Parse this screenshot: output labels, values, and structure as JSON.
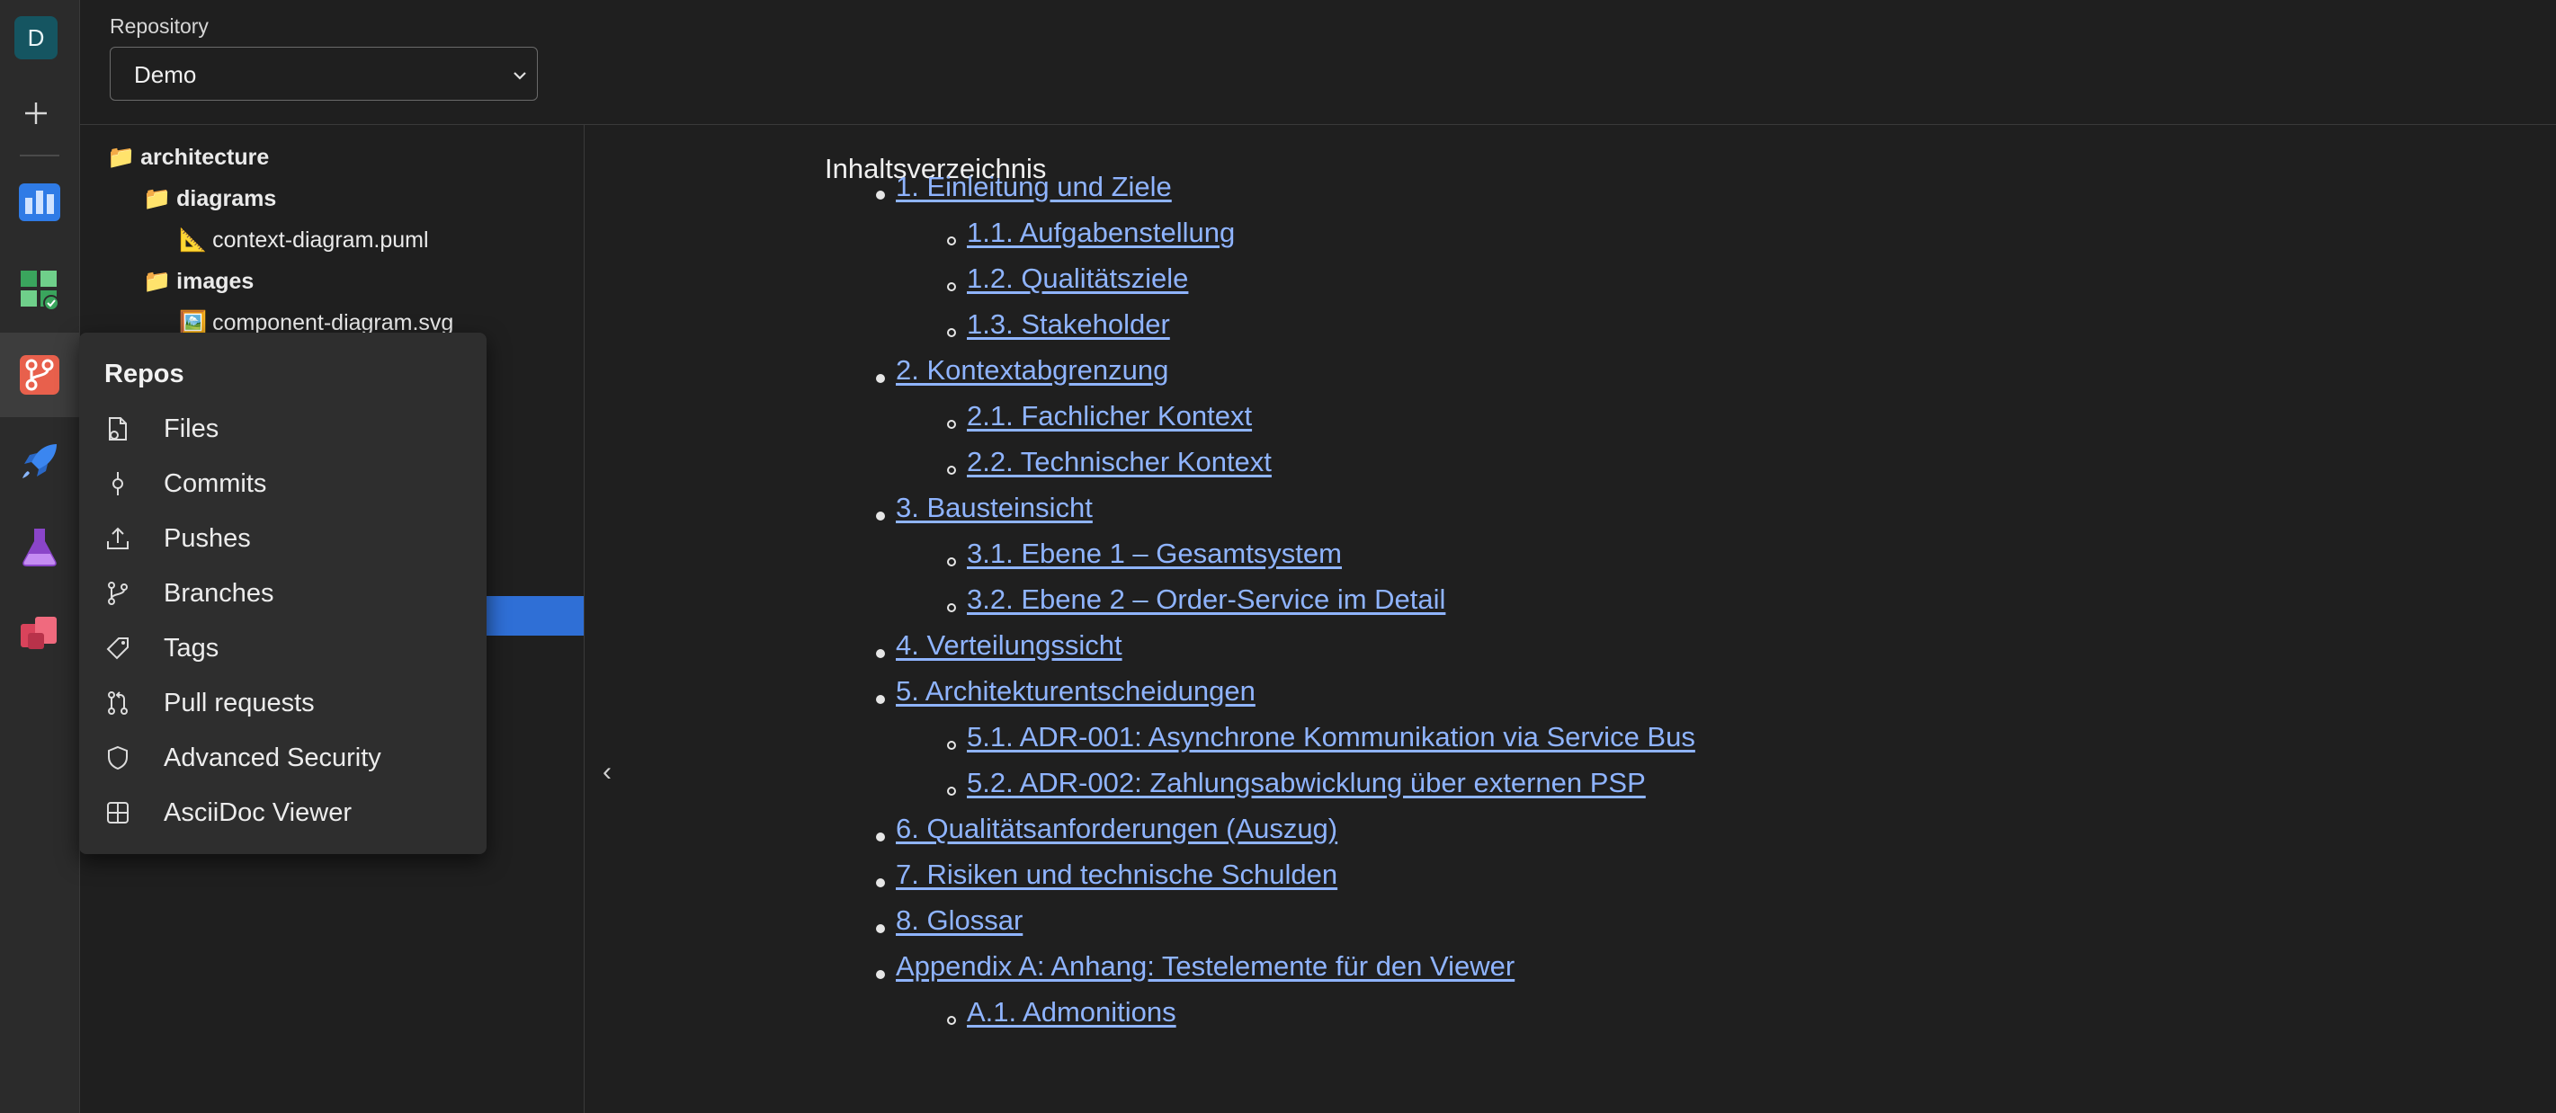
{
  "rail": {
    "avatar_letter": "D",
    "accent": "#155561"
  },
  "header": {
    "repo_label": "Repository",
    "repo_value": "Demo"
  },
  "tree": {
    "nodes": [
      {
        "label": "architecture",
        "icon": "folder-icon",
        "bold": true
      },
      {
        "label": "diagrams",
        "icon": "folder-icon",
        "bold": true
      },
      {
        "label": "context-diagram.puml",
        "icon": "triangle-ruler-icon",
        "bold": false
      },
      {
        "label": "images",
        "icon": "folder-icon",
        "bold": true
      },
      {
        "label": "component-diagram.svg",
        "icon": "image-file-icon",
        "bold": false
      }
    ]
  },
  "flyout": {
    "title": "Repos",
    "items": [
      {
        "label": "Files",
        "icon": "file-icon"
      },
      {
        "label": "Commits",
        "icon": "commit-icon"
      },
      {
        "label": "Pushes",
        "icon": "push-icon"
      },
      {
        "label": "Branches",
        "icon": "branch-icon"
      },
      {
        "label": "Tags",
        "icon": "tag-icon"
      },
      {
        "label": "Pull requests",
        "icon": "pull-request-icon"
      },
      {
        "label": "Advanced Security",
        "icon": "shield-icon"
      },
      {
        "label": "AsciiDoc Viewer",
        "icon": "grid-icon"
      }
    ]
  },
  "toc": {
    "title": "Inhaltsverzeichnis",
    "items": [
      {
        "label": "1. Einleitung und Ziele",
        "level": 1
      },
      {
        "label": "1.1. Aufgabenstellung",
        "level": 2
      },
      {
        "label": "1.2. Qualitätsziele",
        "level": 2
      },
      {
        "label": "1.3. Stakeholder",
        "level": 2
      },
      {
        "label": "2. Kontextabgrenzung",
        "level": 1
      },
      {
        "label": "2.1. Fachlicher Kontext",
        "level": 2
      },
      {
        "label": "2.2. Technischer Kontext",
        "level": 2
      },
      {
        "label": "3. Bausteinsicht",
        "level": 1
      },
      {
        "label": "3.1. Ebene 1 – Gesamtsystem",
        "level": 2
      },
      {
        "label": "3.2. Ebene 2 – Order-Service im Detail",
        "level": 2
      },
      {
        "label": "4. Verteilungssicht",
        "level": 1
      },
      {
        "label": "5. Architekturentscheidungen",
        "level": 1
      },
      {
        "label": "5.1. ADR-001: Asynchrone Kommunikation via Service Bus",
        "level": 2
      },
      {
        "label": "5.2. ADR-002: Zahlungsabwicklung über externen PSP",
        "level": 2
      },
      {
        "label": "6. Qualitätsanforderungen (Auszug)",
        "level": 1
      },
      {
        "label": "7. Risiken und technische Schulden",
        "level": 1
      },
      {
        "label": "8. Glossar",
        "level": 1
      },
      {
        "label": "Appendix A: Anhang: Testelemente für den Viewer",
        "level": 1
      },
      {
        "label": "A.1. Admonitions",
        "level": 2
      }
    ]
  },
  "colors": {
    "link": "#8fb4ff",
    "selection": "#2f6fd6"
  }
}
